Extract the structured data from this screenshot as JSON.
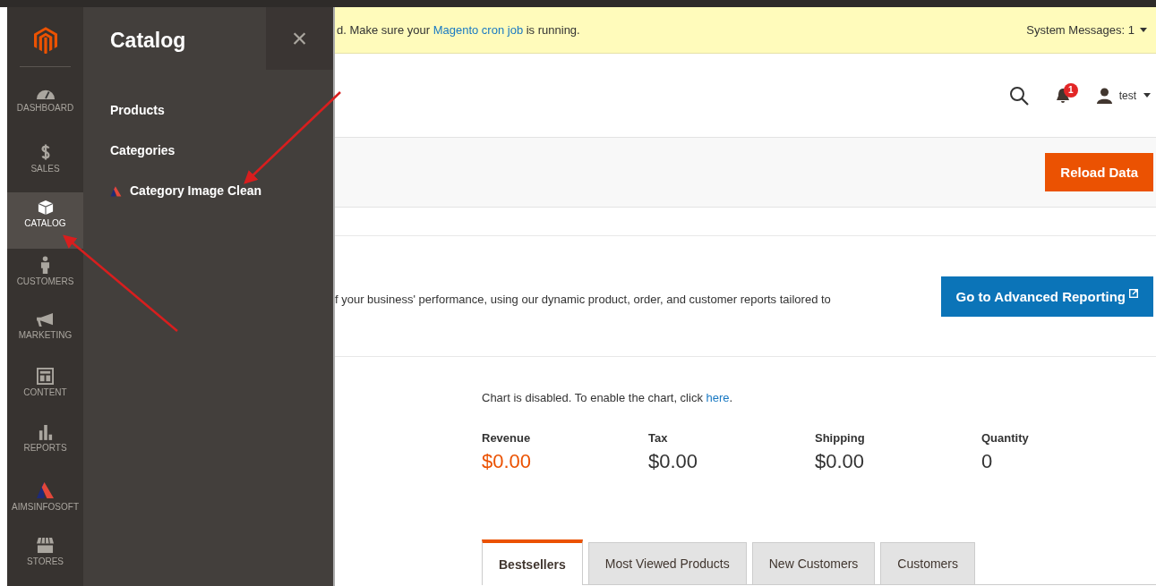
{
  "sidebar": {
    "items": [
      {
        "label": "DASHBOARD",
        "selected": false
      },
      {
        "label": "SALES",
        "selected": false
      },
      {
        "label": "CATALOG",
        "selected": true
      },
      {
        "label": "CUSTOMERS",
        "selected": false
      },
      {
        "label": "MARKETING",
        "selected": false
      },
      {
        "label": "CONTENT",
        "selected": false
      },
      {
        "label": "REPORTS",
        "selected": false
      },
      {
        "label": "AIMSINFOSOFT",
        "selected": false
      },
      {
        "label": "STORES",
        "selected": false
      }
    ]
  },
  "flyout": {
    "title": "Catalog",
    "close": "×",
    "items": [
      {
        "label": "Products",
        "kind": "plain"
      },
      {
        "label": "Categories",
        "kind": "plain"
      },
      {
        "label": "Category Image Clean",
        "kind": "extension"
      }
    ]
  },
  "notice": {
    "before": "d. Make sure your ",
    "link": "Magento cron job",
    "after": " is running.",
    "system_messages": "System Messages: 1"
  },
  "header": {
    "notifications": "1",
    "user": "test"
  },
  "reload_button": "Reload Data",
  "reporting": {
    "text": "f your business' performance, using our dynamic product, order, and customer reports tailored to",
    "button": "Go to Advanced Reporting"
  },
  "chart_notice": {
    "text": "Chart is disabled. To enable the chart, click ",
    "link": "here",
    "after": "."
  },
  "stats": [
    {
      "label": "Revenue",
      "value": "$0.00",
      "highlighted": true
    },
    {
      "label": "Tax",
      "value": "$0.00",
      "highlighted": false
    },
    {
      "label": "Shipping",
      "value": "$0.00",
      "highlighted": false
    },
    {
      "label": "Quantity",
      "value": "0",
      "highlighted": false
    }
  ],
  "tabs": [
    {
      "label": "Bestsellers",
      "selected": true
    },
    {
      "label": "Most Viewed Products",
      "selected": false
    },
    {
      "label": "New Customers",
      "selected": false
    },
    {
      "label": "Customers",
      "selected": false
    }
  ]
}
